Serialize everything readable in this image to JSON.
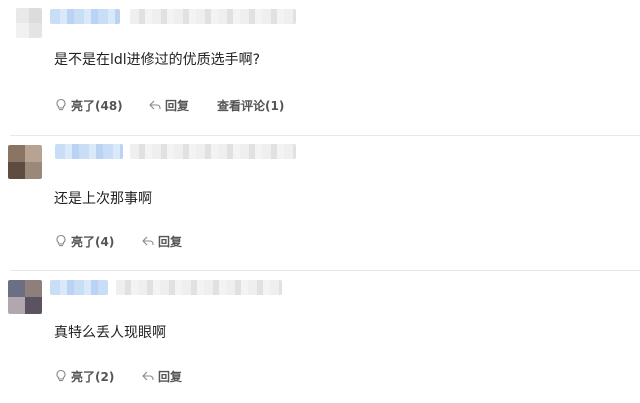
{
  "comments": [
    {
      "text": "是不是在ldl进修过的优质选手啊?",
      "actions": {
        "like_label": "亮了(48)",
        "reply_label": "回复",
        "view_replies_label": "查看评论(1)"
      }
    },
    {
      "text": "还是上次那事啊",
      "actions": {
        "like_label": "亮了(4)",
        "reply_label": "回复"
      }
    },
    {
      "text": "真特么丢人现眼啊",
      "actions": {
        "like_label": "亮了(2)",
        "reply_label": "回复"
      }
    }
  ],
  "icons": {
    "like": "bulb-icon",
    "reply": "reply-arrow-icon"
  },
  "colors": {
    "text": "#222222",
    "action_text": "#555555",
    "divider": "#e8e8e8",
    "username_blur": "#c6dcf5",
    "time_blur": "#efefef"
  }
}
